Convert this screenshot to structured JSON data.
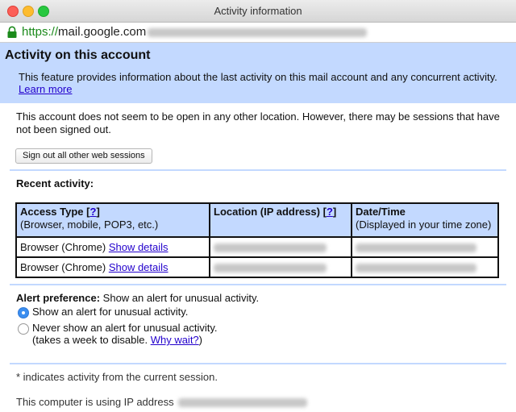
{
  "window": {
    "title": "Activity information"
  },
  "address_bar": {
    "scheme": "https://",
    "host": "mail.google.com"
  },
  "header": {
    "title": "Activity on this account",
    "description": "This feature provides information about the last activity on this mail account and any concurrent activity.",
    "learn_more": "Learn more"
  },
  "session_notice": "This account does not seem to be open in any other location. However, there may be sessions that have not been signed out.",
  "sign_out_button": "Sign out all other web sessions",
  "recent_activity": {
    "heading": "Recent activity:",
    "columns": [
      {
        "title": "Access Type",
        "bracket_open": "[",
        "help": "?",
        "bracket_close": "]",
        "subtitle": "(Browser, mobile, POP3, etc.)"
      },
      {
        "title": "Location (IP address)",
        "bracket_open": "[",
        "help": "?",
        "bracket_close": "]",
        "subtitle": ""
      },
      {
        "title": "Date/Time",
        "subtitle": "(Displayed in your time zone)"
      }
    ],
    "rows": [
      {
        "access_type": "Browser (Chrome)",
        "details_link": "Show details"
      },
      {
        "access_type": "Browser (Chrome)",
        "details_link": "Show details"
      }
    ]
  },
  "alert": {
    "label": "Alert preference:",
    "text": "Show an alert for unusual activity.",
    "options": [
      {
        "label": "Show an alert for unusual activity.",
        "selected": true
      },
      {
        "label": "Never show an alert for unusual activity.",
        "note": "(takes a week to disable.",
        "link": "Why wait?",
        "note_end": ")",
        "selected": false
      }
    ]
  },
  "footnote": "* indicates activity from the current session.",
  "ip_notice": "This computer is using IP address",
  "colors": {
    "header_bg": "#c3d9ff",
    "link": "#2200cc",
    "https_green": "#1b8a1b"
  }
}
